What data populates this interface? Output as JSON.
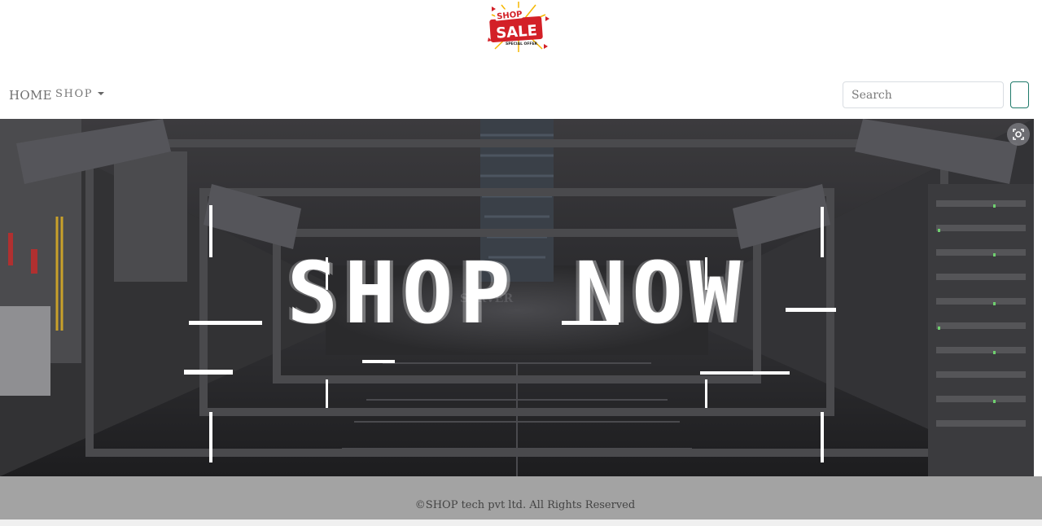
{
  "logo": {
    "shop_text": "SHOP",
    "sale_text": "SALE",
    "offer_text": "SPECIAL OFFER",
    "icon": "shop-sale-logo-icon"
  },
  "nav": {
    "home_label": "HOME",
    "shop_label": "SHOP",
    "shop_dropdown_icon": "caret-down-icon"
  },
  "search": {
    "placeholder": "Search",
    "button_icon": "search-button"
  },
  "hero": {
    "title": "SHOP NOW",
    "lens_icon": "image-search-icon"
  },
  "footer": {
    "text": "©SHOP tech pvt ltd. All Rights Reserved"
  },
  "colors": {
    "accent_red": "#d32027",
    "logo_yellow": "#f5b700",
    "search_button_border": "#1f7a6a",
    "footer_bg": "#a3a3a3"
  }
}
